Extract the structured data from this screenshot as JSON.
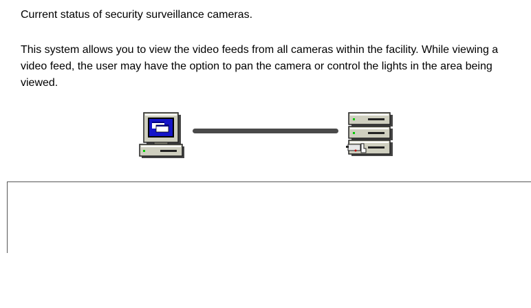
{
  "page": {
    "status_text": "Current status of security surveillance cameras.",
    "description_text": "This system allows you to view the video feeds from all cameras within the facility. While viewing a video feed, the user may have the option to pan the camera or control the lights in the area being viewed."
  },
  "diagram": {
    "client_icon": "computer-workstation-icon",
    "server_icon": "server-stack-icon",
    "link_color": "#4a4a4a",
    "link_status": "connected"
  },
  "colors": {
    "background": "#ffffff",
    "text": "#000000",
    "monitor_screen": "#1515c8",
    "led": "#00cc00"
  }
}
